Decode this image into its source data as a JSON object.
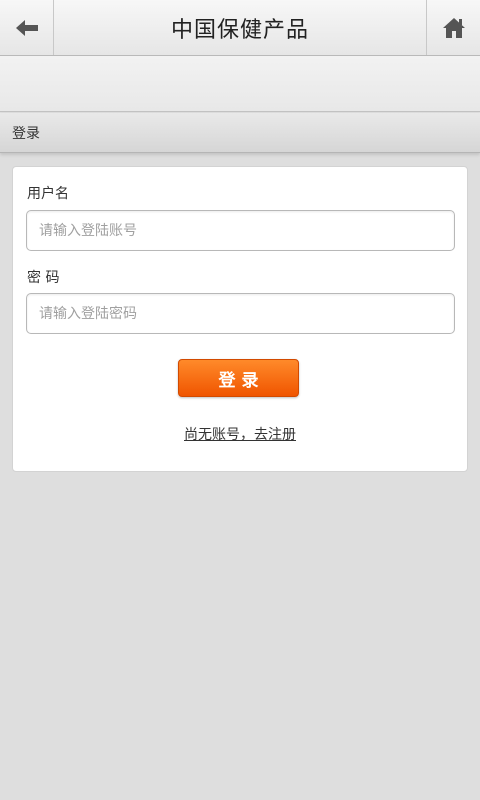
{
  "header": {
    "title": "中国保健产品",
    "back_icon": "arrow-left-icon",
    "home_icon": "home-icon"
  },
  "section": {
    "title": "登录"
  },
  "form": {
    "username_label": "用户名",
    "username_placeholder": "请输入登陆账号",
    "username_value": "",
    "password_label": "密 码",
    "password_placeholder": "请输入登陆密码",
    "password_value": "",
    "login_button": "登录",
    "register_link": "尚无账号，去注册"
  },
  "colors": {
    "accent": "#f05500",
    "background": "#dedede"
  }
}
